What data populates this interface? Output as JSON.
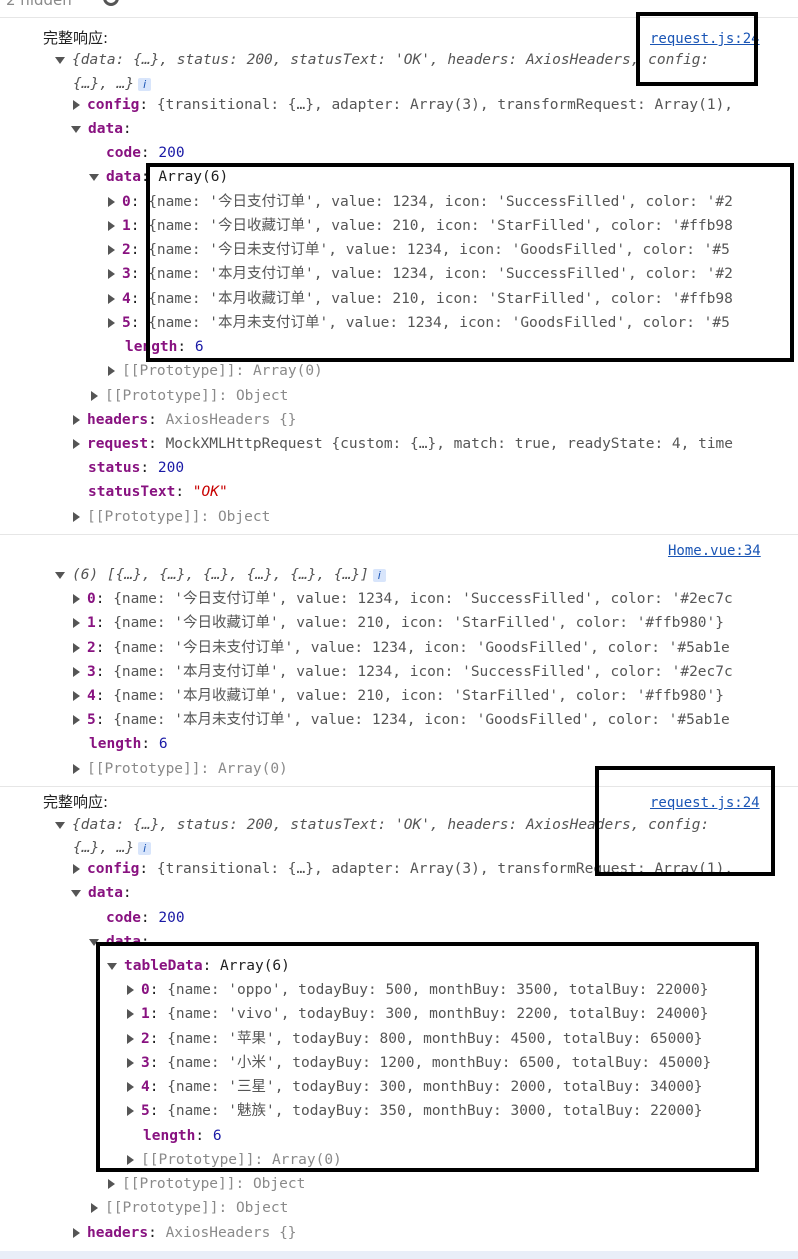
{
  "top_bar": {
    "hidden_label": "2 hidden"
  },
  "log1": {
    "label": "完整响应:",
    "source": "request.js:24",
    "summary_a": "{data: {…}, status: 200, statusText: 'OK', headers: AxiosHeaders, config:",
    "summary_b": "{…}, …}",
    "config": "{transitional: {…}, adapter: Array(3), transformRequest: Array(1),",
    "code": "200",
    "data_type": "Array(6)",
    "rows": [
      "{name: '今日支付订单', value: 1234, icon: 'SuccessFilled', color: '#2",
      "{name: '今日收藏订单', value: 210, icon: 'StarFilled', color: '#ffb98",
      "{name: '今日未支付订单', value: 1234, icon: 'GoodsFilled', color: '#5",
      "{name: '本月支付订单', value: 1234, icon: 'SuccessFilled', color: '#2",
      "{name: '本月收藏订单', value: 210, icon: 'StarFilled', color: '#ffb98",
      "{name: '本月未支付订单', value: 1234, icon: 'GoodsFilled', color: '#5"
    ],
    "length": "6",
    "proto_array": "[[Prototype]]: Array(0)",
    "proto_object": "[[Prototype]]: Object",
    "headers": "AxiosHeaders  {}",
    "request": "MockXMLHttpRequest  {custom: {…}, match: true, readyState: 4, time",
    "status": "200",
    "statusText": "\"OK\""
  },
  "log2": {
    "source": "Home.vue:34",
    "summary": "(6) [{…}, {…}, {…}, {…}, {…}, {…}]",
    "rows": [
      "{name: '今日支付订单', value: 1234, icon: 'SuccessFilled', color: '#2ec7c",
      "{name: '今日收藏订单', value: 210, icon: 'StarFilled', color: '#ffb980'}",
      "{name: '今日未支付订单', value: 1234, icon: 'GoodsFilled', color: '#5ab1e",
      "{name: '本月支付订单', value: 1234, icon: 'SuccessFilled', color: '#2ec7c",
      "{name: '本月收藏订单', value: 210, icon: 'StarFilled', color: '#ffb980'}",
      "{name: '本月未支付订单', value: 1234, icon: 'GoodsFilled', color: '#5ab1e"
    ],
    "length": "6",
    "proto": "[[Prototype]]: Array(0)"
  },
  "log3": {
    "label": "完整响应:",
    "source": "request.js:24",
    "summary_a": "{data: {…}, status: 200, statusText: 'OK', headers: AxiosHeaders, config:",
    "summary_b": "{…}, …}",
    "config": "{transitional: {…}, adapter: Array(3), transformRequest: Array(1),",
    "code": "200",
    "table_type": "Array(6)",
    "rows": [
      "{name: 'oppo', todayBuy: 500, monthBuy: 3500, totalBuy: 22000}",
      "{name: 'vivo', todayBuy: 300, monthBuy: 2200, totalBuy: 24000}",
      "{name: '苹果', todayBuy: 800, monthBuy: 4500, totalBuy: 65000}",
      "{name: '小米', todayBuy: 1200, monthBuy: 6500, totalBuy: 45000}",
      "{name: '三星', todayBuy: 300, monthBuy: 2000, totalBuy: 34000}",
      "{name: '魅族', todayBuy: 350, monthBuy: 3000, totalBuy: 22000}"
    ],
    "length": "6",
    "proto_array": "[[Prototype]]: Array(0)",
    "proto_object": "[[Prototype]]: Object",
    "headers": "AxiosHeaders  {}"
  },
  "keys": {
    "config": "config",
    "data": "data",
    "code": "code",
    "length": "length",
    "headers": "headers",
    "request": "request",
    "status": "status",
    "statusText": "statusText",
    "tableData": "tableData",
    "idx": [
      "0",
      "1",
      "2",
      "3",
      "4",
      "5"
    ]
  }
}
